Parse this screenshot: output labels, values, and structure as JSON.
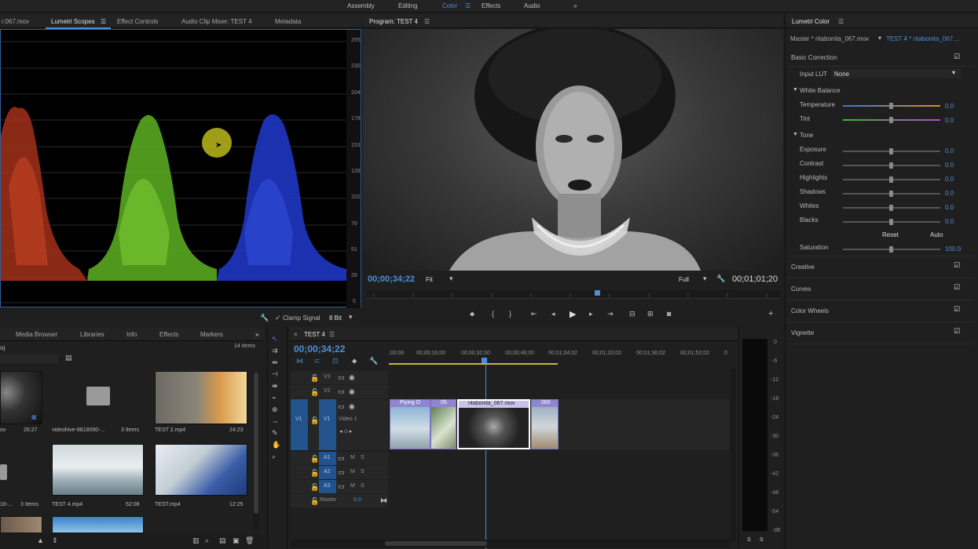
{
  "workspaces": [
    "Assembly",
    "Editing",
    "Color",
    "Effects",
    "Audio"
  ],
  "active_workspace": "Color",
  "scopes_panel": {
    "tabs": [
      "r.067.mov",
      "Lumetri Scopes",
      "Effect Controls",
      "Audio Clip Mixer: TEST 4",
      "Metadata"
    ],
    "scale": [
      "255",
      "230",
      "204",
      "178",
      "153",
      "128",
      "102",
      "76",
      "51",
      "26",
      "0"
    ],
    "clamp_label": "Clamp Signal",
    "bit_depth": "8 Bit"
  },
  "program": {
    "title": "Program: TEST 4",
    "timecode": "00;00;34;22",
    "fit": "Fit",
    "quality": "Full",
    "duration": "00;01;01;20",
    "playhead_position": 0.56
  },
  "lumetri": {
    "title": "Lumetri Color",
    "master_label": "Master * ritabonita_067.mov",
    "seq_label": "TEST 4 * ritabonita_067....",
    "basic_correction": "Basic Correction",
    "input_lut_label": "Input LUT",
    "input_lut_value": "None",
    "white_balance": "White Balance",
    "temperature_label": "Temperature",
    "temperature_value": "0.0",
    "tint_label": "Tint",
    "tint_value": "0.0",
    "tone": "Tone",
    "exposure_label": "Exposure",
    "exposure_value": "0.0",
    "contrast_label": "Contrast",
    "contrast_value": "0.0",
    "highlights_label": "Highlights",
    "highlights_value": "0.0",
    "shadows_label": "Shadows",
    "shadows_value": "0.0",
    "whites_label": "Whites",
    "whites_value": "0.0",
    "blacks_label": "Blacks",
    "blacks_value": "0.0",
    "reset": "Reset",
    "auto": "Auto",
    "saturation_label": "Saturation",
    "saturation_value": "100.0",
    "sections": [
      "Creative",
      "Curves",
      "Color Wheels",
      "Vignette"
    ]
  },
  "project": {
    "tabs": [
      "Media Browser",
      "Libraries",
      "Info",
      "Effects",
      "Markers"
    ],
    "count": "14 Items",
    "items": [
      {
        "name": "ov",
        "duration": "26:27"
      },
      {
        "name": "videohive-9818090-...",
        "duration": "3 Items"
      },
      {
        "name": "TEST 2.mp4",
        "duration": "24:23"
      },
      {
        "name": "16-...",
        "duration": "3 Items"
      },
      {
        "name": "TEST 4.mp4",
        "duration": "52:08"
      },
      {
        "name": "TEST.mp4",
        "duration": "12:25"
      }
    ]
  },
  "timeline": {
    "title": "TEST 4",
    "timecode": "00;00;34;22",
    "ruler": [
      ";00;00",
      "00;00;16;00",
      "00;00;32;00",
      "00;00;48;00",
      "00;01;04;02",
      "00;01;20;02",
      "00;01;36;02",
      "00;01;52;02",
      "0"
    ],
    "tracks_video": [
      "V3",
      "V2",
      "V1"
    ],
    "video1_label": "Video 1",
    "tracks_audio": [
      "A1",
      "A2",
      "A3"
    ],
    "master_label": "Master",
    "master_value": "0.0",
    "clips": [
      "Flying O",
      "05.",
      "ritabonita_067.mov",
      "000"
    ],
    "meter_scale": [
      "0",
      "-6",
      "-12",
      "-18",
      "-24",
      "-30",
      "-36",
      "-42",
      "-48",
      "-54",
      "dB"
    ],
    "meter_solo": [
      "S",
      "S"
    ]
  },
  "colors": {
    "accent": "#4d8fd6",
    "clip": "#8f86d1",
    "red": "#c23a1f",
    "green": "#6fc42a",
    "blue": "#2340d0"
  }
}
